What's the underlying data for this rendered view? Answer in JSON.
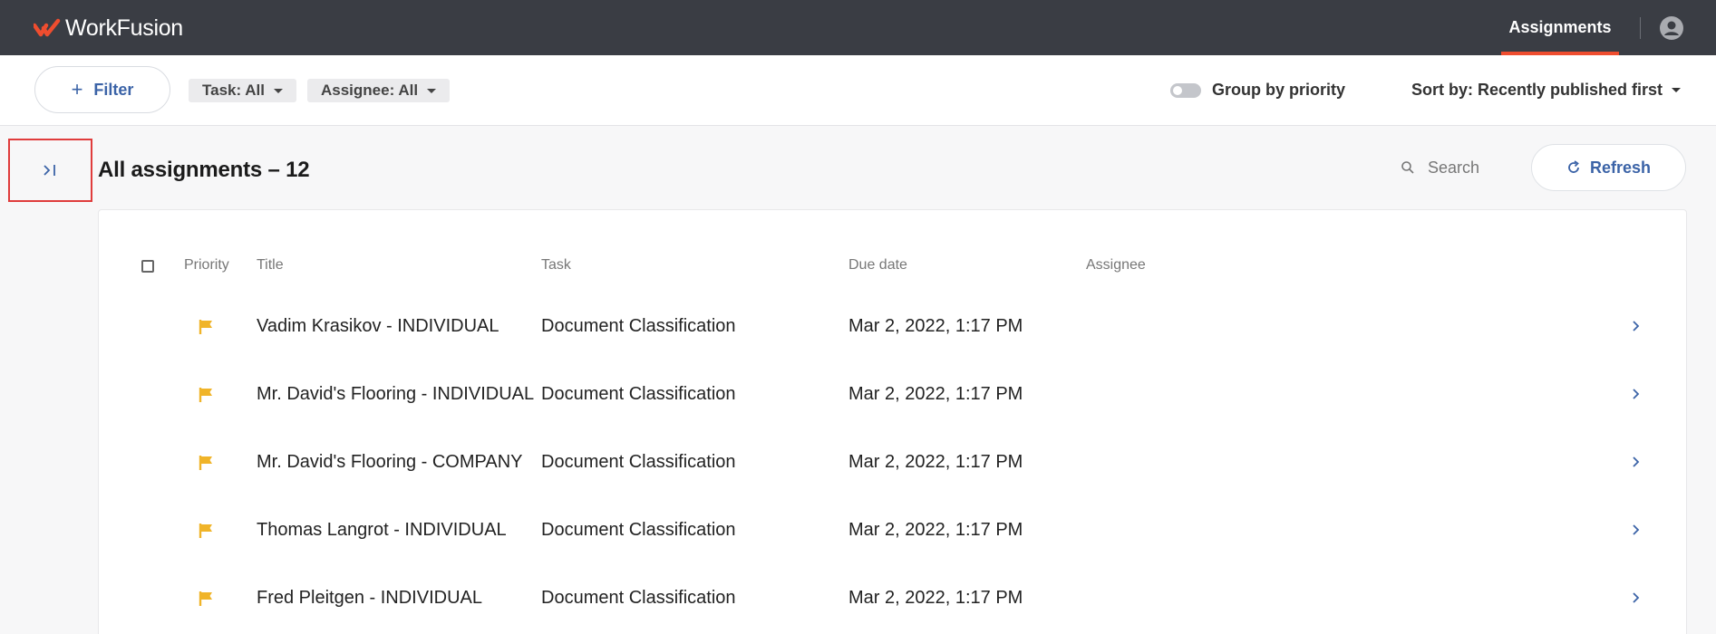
{
  "app": {
    "brand": "WorkFusion",
    "nav_tab": "Assignments"
  },
  "filters": {
    "filter_label": "Filter",
    "task_chip": "Task: All",
    "assignee_chip": "Assignee: All",
    "group_toggle_label": "Group by priority",
    "group_toggle_on": false,
    "sort_label": "Sort by: Recently published first"
  },
  "main": {
    "title": "All assignments – 12",
    "search_placeholder": "Search",
    "refresh_label": "Refresh"
  },
  "table": {
    "columns": {
      "priority": "Priority",
      "title": "Title",
      "task": "Task",
      "due_date": "Due date",
      "assignee": "Assignee"
    },
    "rows": [
      {
        "title": "Vadim Krasikov - INDIVIDUAL",
        "task": "Document Classification",
        "due": "Mar 2, 2022, 1:17 PM",
        "assignee": ""
      },
      {
        "title": "Mr. David's Flooring - INDIVIDUAL",
        "task": "Document Classification",
        "due": "Mar 2, 2022, 1:17 PM",
        "assignee": ""
      },
      {
        "title": "Mr. David's Flooring - COMPANY",
        "task": "Document Classification",
        "due": "Mar 2, 2022, 1:17 PM",
        "assignee": ""
      },
      {
        "title": "Thomas Langrot - INDIVIDUAL",
        "task": "Document Classification",
        "due": "Mar 2, 2022, 1:17 PM",
        "assignee": ""
      },
      {
        "title": "Fred Pleitgen - INDIVIDUAL",
        "task": "Document Classification",
        "due": "Mar 2, 2022, 1:17 PM",
        "assignee": ""
      }
    ]
  },
  "colors": {
    "topbar": "#3a3d44",
    "accent": "#ef4d2f",
    "link_blue": "#3b63a7",
    "priority_flag": "#f0b429"
  },
  "icons": {
    "logo": "workfusion-logo-icon",
    "user": "user-circle-icon",
    "plus": "plus-icon",
    "sidebar_toggle": "expand-sidebar-icon",
    "search": "search-icon",
    "refresh": "refresh-icon",
    "flag": "flag-icon",
    "chevron": "chevron-right-icon"
  }
}
